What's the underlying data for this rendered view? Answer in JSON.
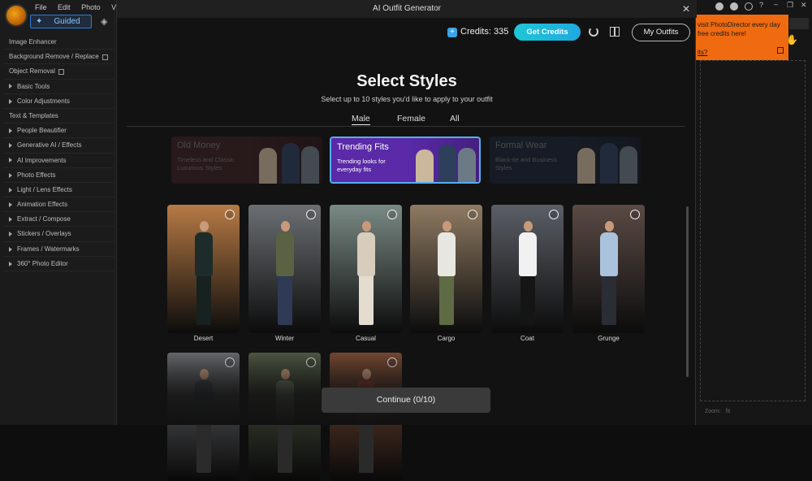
{
  "app": {
    "menu": [
      "File",
      "Edit",
      "Photo",
      "View"
    ],
    "mode_label": "Guided",
    "nav_items": [
      {
        "label": "Image Enhancer",
        "type": "plain"
      },
      {
        "label": "Background Remove / Replace",
        "type": "ext"
      },
      {
        "label": "Object Removal",
        "type": "ext"
      },
      {
        "label": "Basic Tools",
        "type": "group"
      },
      {
        "label": "Color Adjustments",
        "type": "group"
      },
      {
        "label": "Text & Templates",
        "type": "plain"
      },
      {
        "label": "People Beautifier",
        "type": "group"
      },
      {
        "label": "Generative AI / Effects",
        "type": "group"
      },
      {
        "label": "AI Improvements",
        "type": "group"
      },
      {
        "label": "Photo Effects",
        "type": "group"
      },
      {
        "label": "Light / Lens Effects",
        "type": "group"
      },
      {
        "label": "Animation Effects",
        "type": "group"
      },
      {
        "label": "Extract / Compose",
        "type": "group"
      },
      {
        "label": "Stickers / Overlays",
        "type": "group"
      },
      {
        "label": "Frames / Watermarks",
        "type": "group"
      },
      {
        "label": "360° Photo Editor",
        "type": "group"
      }
    ],
    "promo": {
      "line1": "visit PhotoDirector every day",
      "line2": "free credits here!",
      "link": "its?"
    },
    "zoom_label": "Zoom:",
    "zoom_value": "fit"
  },
  "modal": {
    "title": "AI Outfit Generator",
    "close_glyph": "✕",
    "credits_label": "Credits: 335",
    "get_credits": "Get Credits",
    "my_outfits": "My Outfits",
    "heading": "Select Styles",
    "subheading": "Select up to 10 styles you'd like to apply to your outfit",
    "tabs": [
      "Male",
      "Female",
      "All"
    ],
    "active_tab": "Male",
    "categories": [
      {
        "title": "Old Money",
        "desc": "Timeless and Classic Luxurious Styles",
        "state": "dim",
        "bg": "#3a1f24"
      },
      {
        "title": "Trending Fits",
        "desc": "Trending looks for everyday fits",
        "state": "selected",
        "bg": "#5a2aa8"
      },
      {
        "title": "Formal Wear",
        "desc": "Black-tie and Business Styles",
        "state": "dim",
        "bg": "#1c2436"
      }
    ],
    "styles": [
      {
        "label": "Desert",
        "bg": "#b77a45",
        "top": "#1e2b2b",
        "bottom": "#17211f"
      },
      {
        "label": "Winter",
        "bg": "#6b6f73",
        "top": "#5b6244",
        "bottom": "#2f3a55"
      },
      {
        "label": "Casual",
        "bg": "#7a8a85",
        "top": "#d8ccbc",
        "bottom": "#e3dccf"
      },
      {
        "label": "Cargo",
        "bg": "#8f7a62",
        "top": "#e8e6e0",
        "bottom": "#5e6b45"
      },
      {
        "label": "Coat",
        "bg": "#5b5f66",
        "top": "#f1f1f1",
        "bottom": "#151515"
      },
      {
        "label": "Grunge",
        "bg": "#5a4a44",
        "top": "#a9c3dd",
        "bottom": "#2a2d33"
      },
      {
        "label": "",
        "bg": "#6a6c70",
        "top": "#3b4048",
        "bottom": "#2b2b2b"
      },
      {
        "label": "",
        "bg": "#4f5a44",
        "top": "#6d7a60",
        "bottom": "#2a2a2a"
      },
      {
        "label": "",
        "bg": "#7a4a34",
        "top": "#8a3a2a",
        "bottom": "#2a2a2a"
      }
    ],
    "continue_label": "Continue (0/10)"
  }
}
